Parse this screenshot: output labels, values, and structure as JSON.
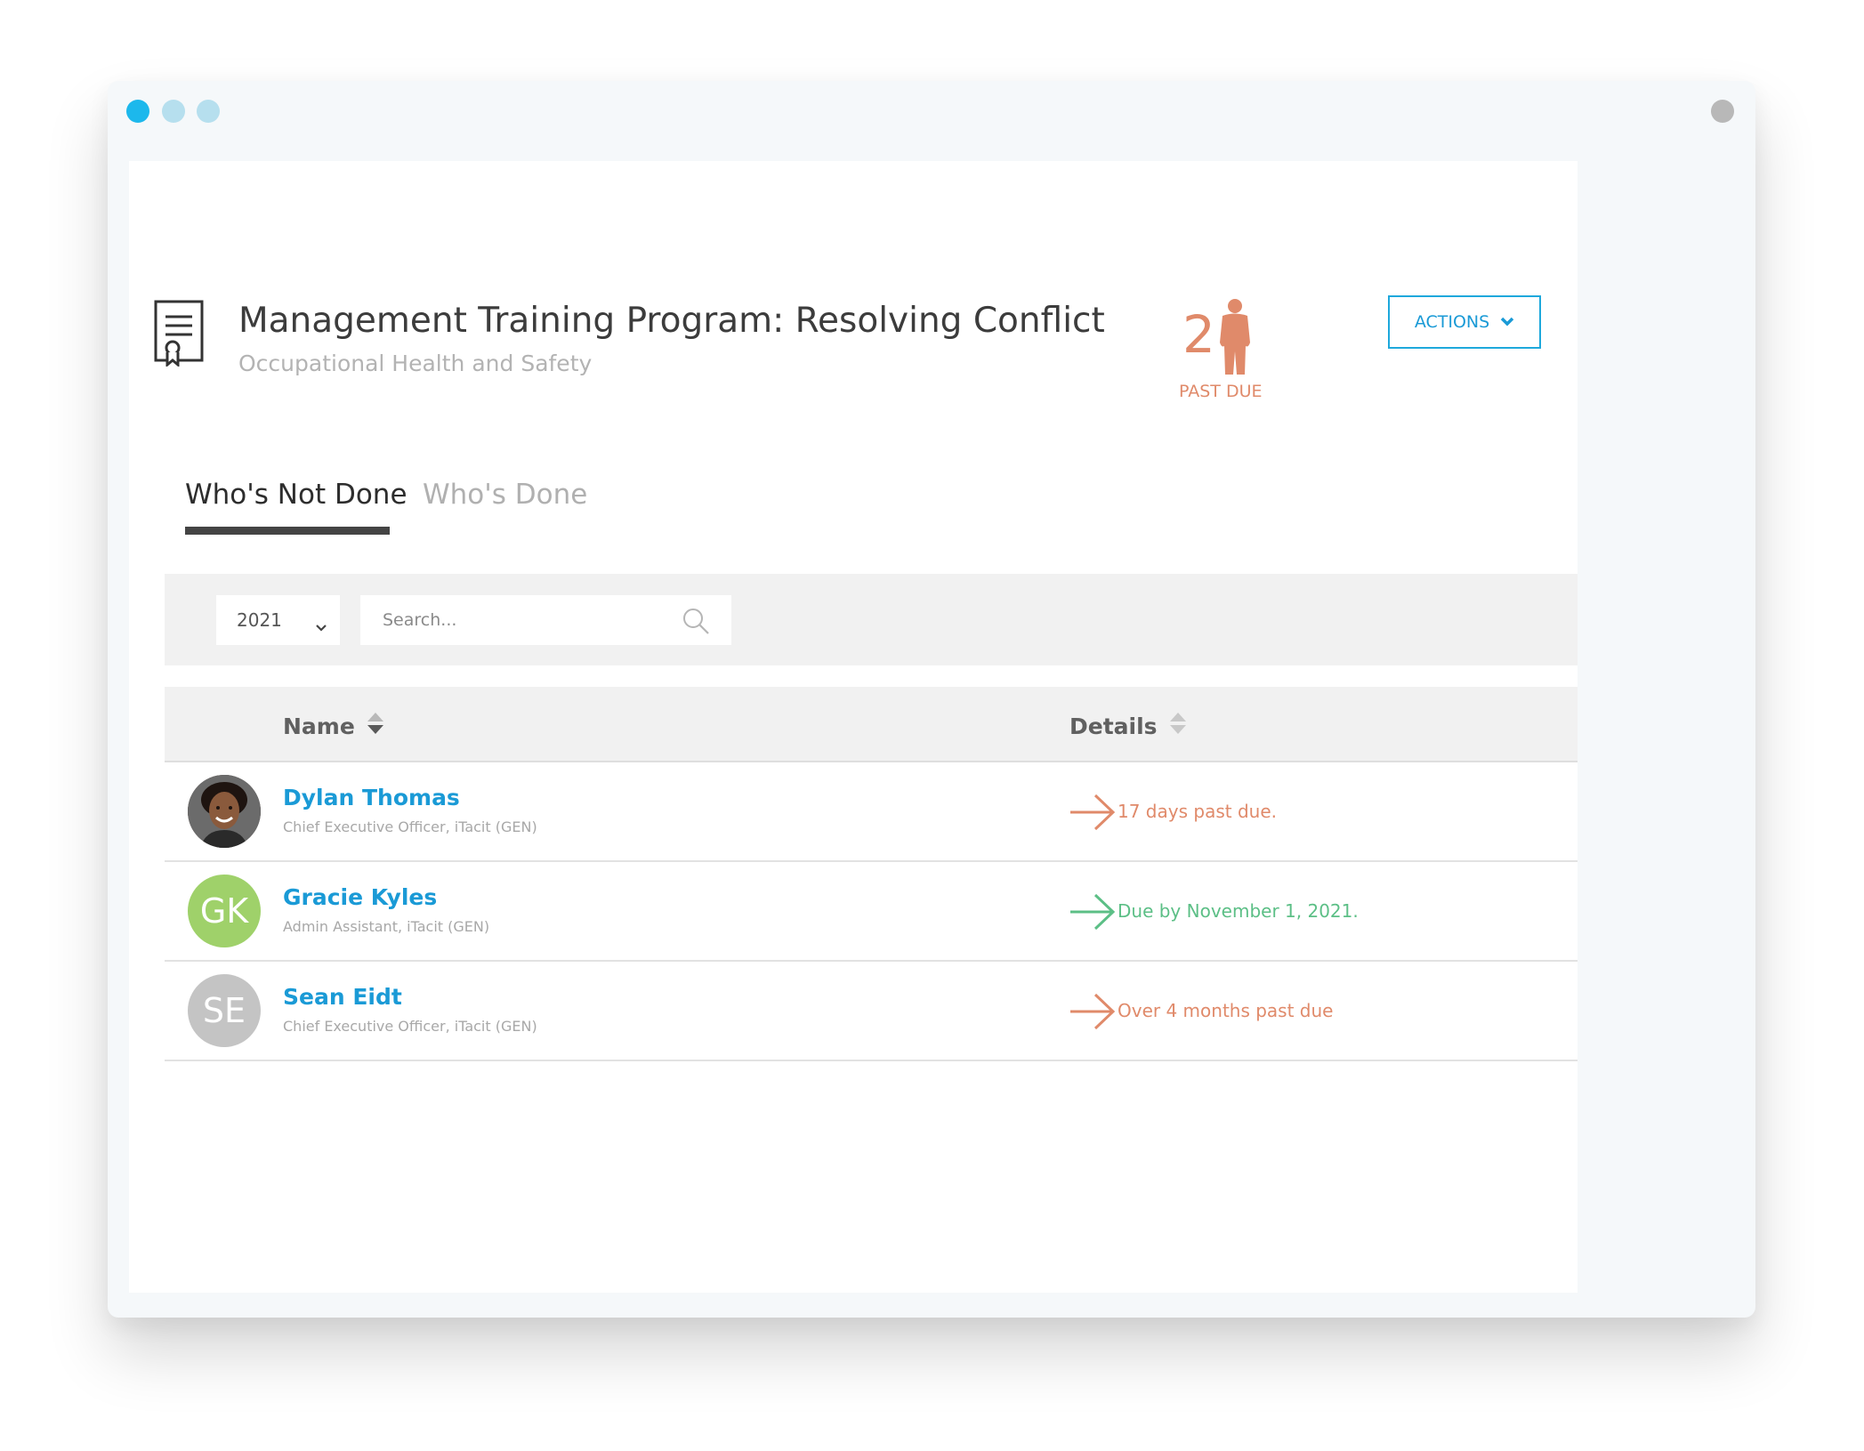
{
  "header": {
    "title": "Management Training Program: Resolving Conflict",
    "subtitle": "Occupational Health and Safety",
    "past_due_count": "2",
    "past_due_label": "PAST DUE",
    "actions_label": "ACTIONS"
  },
  "tabs": [
    {
      "label": "Who's Not Done",
      "active": true
    },
    {
      "label": "Who's Done",
      "active": false
    }
  ],
  "filters": {
    "year": "2021",
    "search_placeholder": "Search..."
  },
  "table": {
    "columns": [
      "Name",
      "Details"
    ],
    "rows": [
      {
        "name": "Dylan Thomas",
        "role": "Chief Executive Officer, iTacit (GEN)",
        "avatar_initials": "",
        "avatar_type": "photo",
        "detail": "17 days past due.",
        "status": "past-due"
      },
      {
        "name": "Gracie Kyles",
        "role": "Admin Assistant, iTacit (GEN)",
        "avatar_initials": "GK",
        "avatar_type": "initials",
        "detail": "Due by November 1, 2021.",
        "status": "upcoming"
      },
      {
        "name": "Sean Eidt",
        "role": "Chief Executive Officer, iTacit (GEN)",
        "avatar_initials": "SE",
        "avatar_type": "initials",
        "detail": "Over 4 months past due",
        "status": "past-due"
      }
    ]
  },
  "colors": {
    "accent": "#1a9ad6",
    "past_due": "#e08a6a",
    "upcoming": "#5cbf86",
    "avatar_gk": "#9fd16a",
    "avatar_se": "#c4c4c4"
  },
  "icons": [
    "certificate-document-icon",
    "person-silhouette-icon",
    "chevron-down-icon",
    "search-icon",
    "sort-icon",
    "arrow-right-icon"
  ]
}
